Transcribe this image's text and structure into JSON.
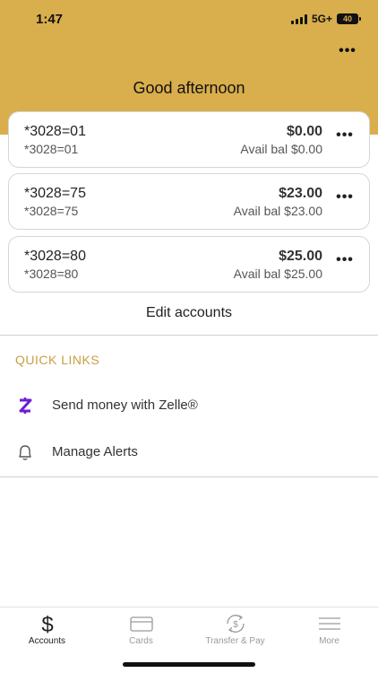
{
  "status_bar": {
    "time": "1:47",
    "network": "5G+",
    "battery": "40"
  },
  "header": {
    "greeting": "Good afternoon",
    "more_icon": "more-horizontal-icon"
  },
  "accounts": [
    {
      "name": "*3028=01",
      "sub": "*3028=01",
      "balance": "$0.00",
      "avail": "Avail bal $0.00"
    },
    {
      "name": "*3028=75",
      "sub": "*3028=75",
      "balance": "$23.00",
      "avail": "Avail bal $23.00"
    },
    {
      "name": "*3028=80",
      "sub": "*3028=80",
      "balance": "$25.00",
      "avail": "Avail bal $25.00"
    }
  ],
  "edit_accounts_label": "Edit accounts",
  "quick_links": {
    "title": "QUICK LINKS",
    "items": [
      {
        "label": "Send money with Zelle®",
        "icon": "zelle-icon"
      },
      {
        "label": "Manage Alerts",
        "icon": "bell-icon"
      }
    ]
  },
  "tabs": [
    {
      "label": "Accounts",
      "icon": "dollar-icon",
      "active": true
    },
    {
      "label": "Cards",
      "icon": "card-icon",
      "active": false
    },
    {
      "label": "Transfer & Pay",
      "icon": "transfer-icon",
      "active": false
    },
    {
      "label": "More",
      "icon": "menu-icon",
      "active": false
    }
  ],
  "colors": {
    "brand": "#d9ae4c",
    "zelle": "#6d1ed4"
  }
}
